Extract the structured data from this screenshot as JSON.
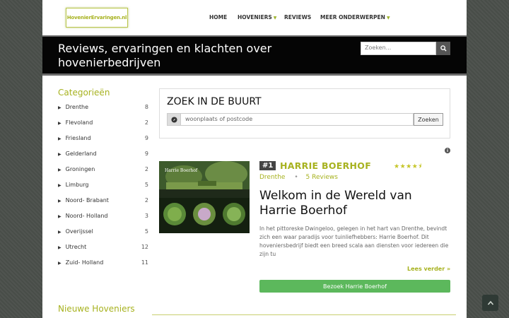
{
  "header": {
    "logo_text": "HovenierErvaringen.nl",
    "nav": [
      {
        "label": "HOME",
        "has_dropdown": false
      },
      {
        "label": "HOVENIERS",
        "has_dropdown": true
      },
      {
        "label": "REVIEWS",
        "has_dropdown": false
      },
      {
        "label": "MEER ONDERWERPEN",
        "has_dropdown": true
      }
    ]
  },
  "hero": {
    "title": "Reviews, ervaringen en klachten over hovenierbedrijven",
    "search_placeholder": "Zoeken...",
    "search_icon": "search-icon"
  },
  "sidebar": {
    "title": "Categorieën",
    "items": [
      {
        "label": "Drenthe",
        "count": "8"
      },
      {
        "label": "Flevoland",
        "count": "2"
      },
      {
        "label": "Friesland",
        "count": "9"
      },
      {
        "label": "Gelderland",
        "count": "9"
      },
      {
        "label": "Groningen",
        "count": "2"
      },
      {
        "label": "Limburg",
        "count": "5"
      },
      {
        "label": "Noord- Brabant",
        "count": "2"
      },
      {
        "label": "Noord- Holland",
        "count": "3"
      },
      {
        "label": "Overijssel",
        "count": "5"
      },
      {
        "label": "Utrecht",
        "count": "12"
      },
      {
        "label": "Zuid- Holland",
        "count": "11"
      }
    ],
    "new_title": "Nieuwe Hoveniers"
  },
  "nearby": {
    "title": "ZOEK IN DE BUURT",
    "placeholder": "woonplaats of postcode",
    "button": "Zoeken"
  },
  "listing": {
    "rank": "#1",
    "name": "HARRIE BOERHOF",
    "rating": 4.5,
    "location": "Drenthe",
    "separator": "•",
    "reviews": "5 Reviews",
    "headline": "Welkom in de Wereld van Harrie Boerhof",
    "description": "In het pittoreske Dwingeloo, gelegen in het hart van Drenthe, bevindt zich een waar paradijs voor tuinliefhebbers: Harrie Boerhof. Dit hoveniersbedrijf biedt een breed scala aan diensten voor iedereen die zijn tu",
    "read_more": "Lees verder »",
    "visit_button": "Bezoek Harrie Boerhof",
    "thumb_title": "Harrie Boerhof"
  },
  "colors": {
    "accent": "#a7b21f",
    "green_button": "#5cb85c",
    "hero_bg": "#050505"
  }
}
